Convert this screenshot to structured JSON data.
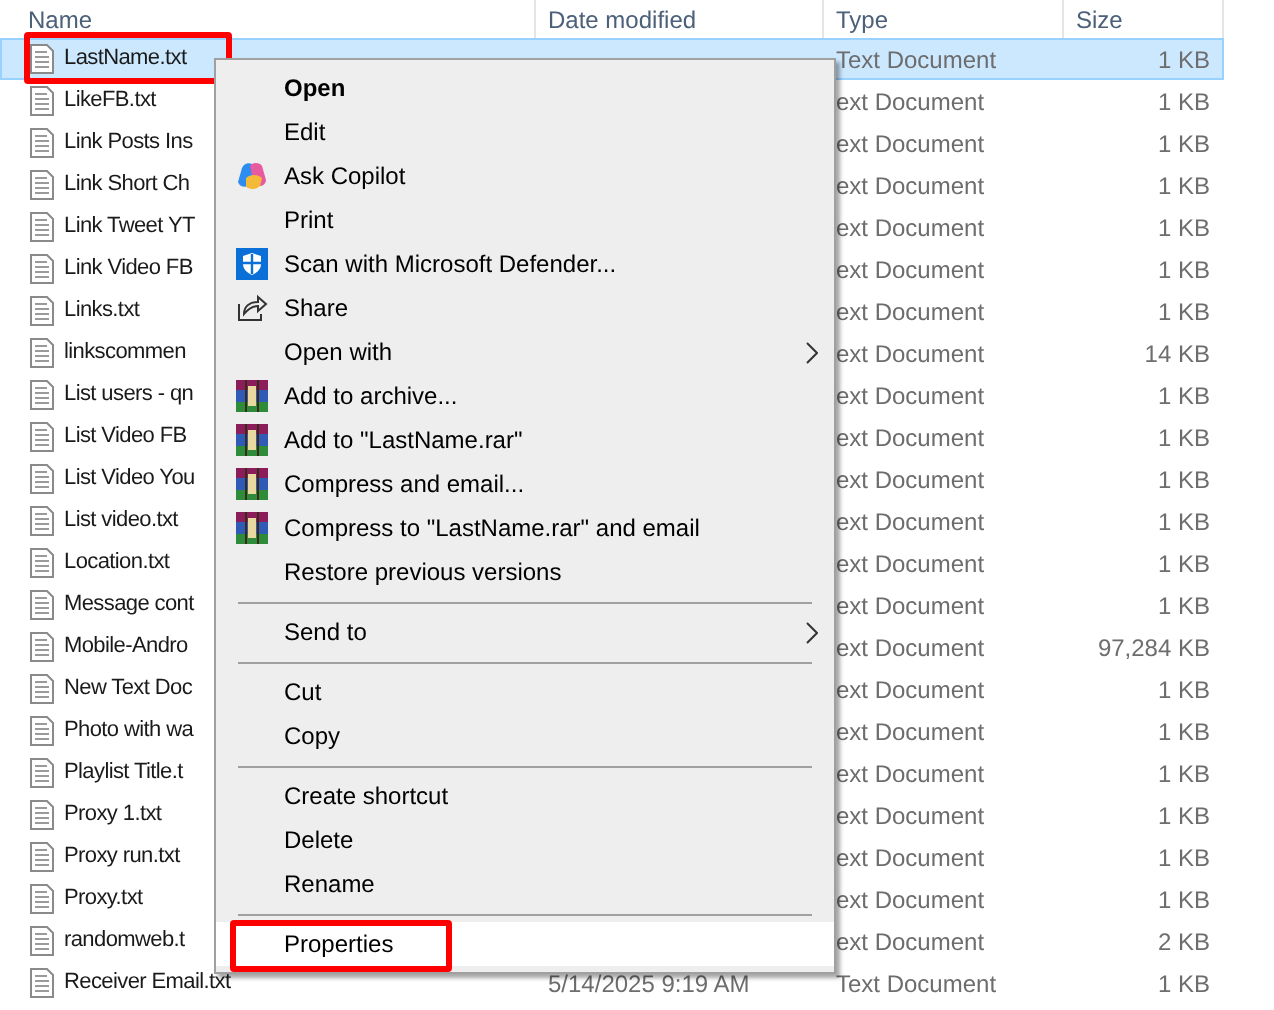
{
  "columns": [
    {
      "label": "Name"
    },
    {
      "label": "Date modified"
    },
    {
      "label": "Type"
    },
    {
      "label": "Size"
    }
  ],
  "rows": [
    {
      "name": "LastName.txt",
      "type": "Text Document",
      "size": "1 KB",
      "selected": true,
      "annotated": true
    },
    {
      "name": "LikeFB.txt",
      "type": "ext Document",
      "size": "1 KB",
      "selected": false,
      "annotated": false
    },
    {
      "name": "Link Posts Ins",
      "type": "ext Document",
      "size": "1 KB",
      "selected": false,
      "annotated": false
    },
    {
      "name": "Link Short Ch",
      "type": "ext Document",
      "size": "1 KB",
      "selected": false,
      "annotated": false
    },
    {
      "name": "Link Tweet YT",
      "type": "ext Document",
      "size": "1 KB",
      "selected": false,
      "annotated": false
    },
    {
      "name": "Link Video FB",
      "type": "ext Document",
      "size": "1 KB",
      "selected": false,
      "annotated": false
    },
    {
      "name": "Links.txt",
      "type": "ext Document",
      "size": "1 KB",
      "selected": false,
      "annotated": false
    },
    {
      "name": "linkscommen",
      "type": "ext Document",
      "size": "14 KB",
      "selected": false,
      "annotated": false
    },
    {
      "name": "List users - qn",
      "type": "ext Document",
      "size": "1 KB",
      "selected": false,
      "annotated": false
    },
    {
      "name": "List Video FB",
      "type": "ext Document",
      "size": "1 KB",
      "selected": false,
      "annotated": false
    },
    {
      "name": "List Video You",
      "type": "ext Document",
      "size": "1 KB",
      "selected": false,
      "annotated": false
    },
    {
      "name": "List video.txt",
      "type": "ext Document",
      "size": "1 KB",
      "selected": false,
      "annotated": false
    },
    {
      "name": "Location.txt",
      "type": "ext Document",
      "size": "1 KB",
      "selected": false,
      "annotated": false
    },
    {
      "name": "Message cont",
      "type": "ext Document",
      "size": "1 KB",
      "selected": false,
      "annotated": false
    },
    {
      "name": "Mobile-Andro",
      "type": "ext Document",
      "size": "97,284 KB",
      "selected": false,
      "annotated": false
    },
    {
      "name": "New Text Doc",
      "type": "ext Document",
      "size": "1 KB",
      "selected": false,
      "annotated": false
    },
    {
      "name": "Photo with wa",
      "type": "ext Document",
      "size": "1 KB",
      "selected": false,
      "annotated": false
    },
    {
      "name": "Playlist Title.t",
      "type": "ext Document",
      "size": "1 KB",
      "selected": false,
      "annotated": false
    },
    {
      "name": "Proxy 1.txt",
      "type": "ext Document",
      "size": "1 KB",
      "selected": false,
      "annotated": false
    },
    {
      "name": "Proxy run.txt",
      "type": "ext Document",
      "size": "1 KB",
      "selected": false,
      "annotated": false
    },
    {
      "name": "Proxy.txt",
      "type": "ext Document",
      "size": "1 KB",
      "selected": false,
      "annotated": false
    },
    {
      "name": "randomweb.t",
      "type": "ext Document",
      "size": "2 KB",
      "selected": false,
      "annotated": false
    },
    {
      "name": "Receiver Email.txt",
      "date": "5/14/2025 9:19 AM",
      "type": "Text Document",
      "size": "1 KB",
      "selected": false,
      "annotated": false
    }
  ],
  "context_menu": [
    {
      "kind": "item",
      "label": "Open",
      "default": true
    },
    {
      "kind": "item",
      "label": "Edit"
    },
    {
      "kind": "copilot",
      "label": "Ask Copilot"
    },
    {
      "kind": "item",
      "label": "Print"
    },
    {
      "kind": "defender",
      "label": "Scan with Microsoft Defender..."
    },
    {
      "kind": "share",
      "label": "Share"
    },
    {
      "kind": "item",
      "label": "Open with",
      "submenu": true
    },
    {
      "kind": "archive",
      "label": "Add to archive..."
    },
    {
      "kind": "archive",
      "label": "Add to \"LastName.rar\""
    },
    {
      "kind": "archive",
      "label": "Compress and email..."
    },
    {
      "kind": "archive",
      "label": "Compress to \"LastName.rar\" and email"
    },
    {
      "kind": "item",
      "label": "Restore previous versions"
    },
    {
      "kind": "separator"
    },
    {
      "kind": "item",
      "label": "Send to",
      "submenu": true
    },
    {
      "kind": "separator"
    },
    {
      "kind": "item",
      "label": "Cut"
    },
    {
      "kind": "item",
      "label": "Copy"
    },
    {
      "kind": "separator"
    },
    {
      "kind": "item",
      "label": "Create shortcut"
    },
    {
      "kind": "item",
      "label": "Delete"
    },
    {
      "kind": "item",
      "label": "Rename"
    },
    {
      "kind": "separator"
    },
    {
      "kind": "item",
      "label": "Properties",
      "selected": true,
      "annotated": true
    }
  ]
}
